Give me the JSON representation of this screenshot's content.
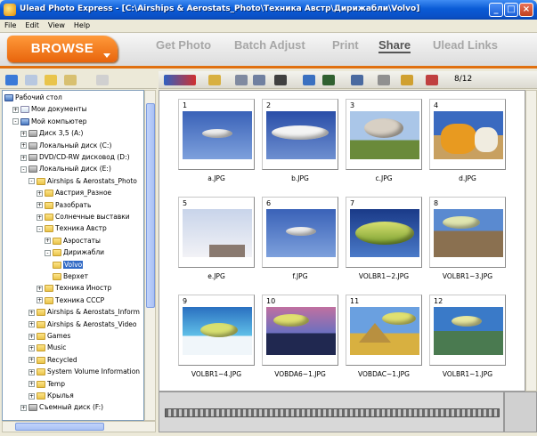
{
  "window": {
    "title": "Ulead Photo Express - [C:\\Airships & Aerostats_Photo\\Техника Австр\\Дирижабли\\Volvo]"
  },
  "menu": [
    "File",
    "Edit",
    "View",
    "Help"
  ],
  "nav": {
    "browse_label": "BROWSE",
    "tabs": [
      "Get Photo",
      "Batch Adjust",
      "Print",
      "Share",
      "Ulead Links"
    ]
  },
  "tree": [
    {
      "label": "Рабочий стол",
      "icon": "desktop",
      "level": 0,
      "exp": ""
    },
    {
      "label": "Мои документы",
      "icon": "doc",
      "level": 1,
      "exp": "+"
    },
    {
      "label": "Мой компьютер",
      "icon": "pc",
      "level": 1,
      "exp": "-"
    },
    {
      "label": "Диск 3,5 (A:)",
      "icon": "drive",
      "level": 2,
      "exp": "+"
    },
    {
      "label": "Локальный диск (C:)",
      "icon": "drive",
      "level": 2,
      "exp": "+"
    },
    {
      "label": "DVD/CD-RW дисковод (D:)",
      "icon": "drive",
      "level": 2,
      "exp": "+"
    },
    {
      "label": "Локальный диск (E:)",
      "icon": "drive",
      "level": 2,
      "exp": "-"
    },
    {
      "label": "Airships & Aerostats_Photo",
      "icon": "folder",
      "level": 3,
      "exp": "-"
    },
    {
      "label": "Австрия_Разное",
      "icon": "folder",
      "level": 4,
      "exp": "+"
    },
    {
      "label": "Разобрать",
      "icon": "folder",
      "level": 4,
      "exp": "+"
    },
    {
      "label": "Солнечные выставки",
      "icon": "folder",
      "level": 4,
      "exp": "+"
    },
    {
      "label": "Техника Австр",
      "icon": "folder",
      "level": 4,
      "exp": "-"
    },
    {
      "label": "Аэростаты",
      "icon": "folder",
      "level": 5,
      "exp": "+"
    },
    {
      "label": "Дирижабли",
      "icon": "folder",
      "level": 5,
      "exp": "-"
    },
    {
      "label": "Volvo",
      "icon": "folder",
      "level": 6,
      "exp": "",
      "selected": true
    },
    {
      "label": "Верхет",
      "icon": "folder",
      "level": 6,
      "exp": ""
    },
    {
      "label": "Техника Иностр",
      "icon": "folder",
      "level": 4,
      "exp": "+"
    },
    {
      "label": "Техника СССР",
      "icon": "folder",
      "level": 4,
      "exp": "+"
    },
    {
      "label": "Airships & Aerostats_Inform",
      "icon": "folder",
      "level": 3,
      "exp": "+"
    },
    {
      "label": "Airships & Aerostats_Video",
      "icon": "folder",
      "level": 3,
      "exp": "+"
    },
    {
      "label": "Games",
      "icon": "folder",
      "level": 3,
      "exp": "+"
    },
    {
      "label": "Music",
      "icon": "folder",
      "level": 3,
      "exp": "+"
    },
    {
      "label": "Recycled",
      "icon": "folder",
      "level": 3,
      "exp": "+"
    },
    {
      "label": "System Volume Information",
      "icon": "folder",
      "level": 3,
      "exp": "+"
    },
    {
      "label": "Temp",
      "icon": "folder",
      "level": 3,
      "exp": "+"
    },
    {
      "label": "Крылья",
      "icon": "folder",
      "level": 3,
      "exp": "+"
    },
    {
      "label": "Съемный диск (F:)",
      "icon": "drive",
      "level": 2,
      "exp": "+"
    }
  ],
  "toolbar": {
    "count": "8/12"
  },
  "photos": [
    {
      "num": "1",
      "file": "a.JPG",
      "scene": "airship-sky"
    },
    {
      "num": "2",
      "file": "b.JPG",
      "scene": "airship-sky2"
    },
    {
      "num": "3",
      "file": "c.JPG",
      "scene": "airship-ground"
    },
    {
      "num": "4",
      "file": "d.JPG",
      "scene": "airship-orange"
    },
    {
      "num": "5",
      "file": "e.JPG",
      "scene": "sky-tall"
    },
    {
      "num": "6",
      "file": "f.JPG",
      "scene": "airship-sky"
    },
    {
      "num": "7",
      "file": "VOLBR1~2.JPG",
      "scene": "volvo-green"
    },
    {
      "num": "8",
      "file": "VOLBR1~3.JPG",
      "scene": "volvo-mountain"
    },
    {
      "num": "9",
      "file": "VOLBR1~4.JPG",
      "scene": "volvo-ice"
    },
    {
      "num": "10",
      "file": "VOBDA6~1.JPG",
      "scene": "volvo-city"
    },
    {
      "num": "11",
      "file": "VOBDAC~1.JPG",
      "scene": "volvo-pyramid"
    },
    {
      "num": "12",
      "file": "VOLBR1~1.JPG",
      "scene": "volvo-lake"
    }
  ],
  "colors": {
    "accent": "#e8640c",
    "selection": "#316ac5",
    "titlebar": "#0a5bd6"
  }
}
